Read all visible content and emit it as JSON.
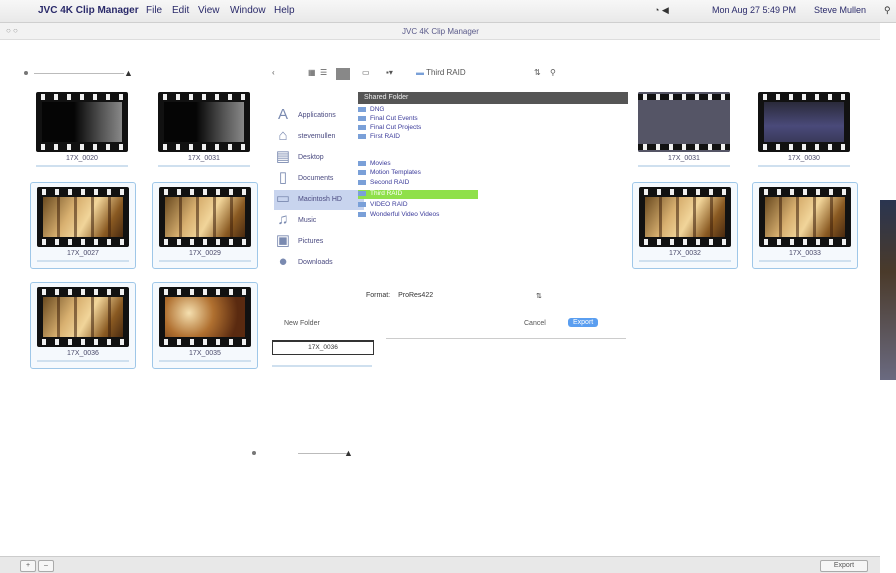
{
  "menubar": {
    "app_name": "JVC 4K Clip Manager",
    "menus": [
      "File",
      "Edit",
      "View",
      "Window",
      "Help"
    ],
    "status_text": "Mon Aug 27 5:49 PM",
    "user": "Steve Mullen"
  },
  "window": {
    "title": "JVC 4K Clip Manager"
  },
  "clips_left": [
    {
      "name": "17X_0020",
      "style": "dark"
    },
    {
      "name": "17X_0031",
      "style": "dark"
    },
    {
      "name": "17X_0027",
      "style": "warm"
    },
    {
      "name": "17X_0029",
      "style": "warm"
    },
    {
      "name": "17X_0036",
      "style": "warm"
    },
    {
      "name": "17X_0035",
      "style": "fest"
    }
  ],
  "clips_right": [
    {
      "name": "17X_0031",
      "style": "grayish"
    },
    {
      "name": "17X_0030",
      "style": "bluish"
    },
    {
      "name": "17X_0032",
      "style": "warm"
    },
    {
      "name": "17X_0033",
      "style": "warm"
    }
  ],
  "dialog": {
    "toolbar_path": "Third RAID",
    "sidebar": [
      {
        "label": "Applications",
        "icon": "applications-icon"
      },
      {
        "label": "stevemullen",
        "icon": "home-icon"
      },
      {
        "label": "Desktop",
        "icon": "desktop-icon"
      },
      {
        "label": "Documents",
        "icon": "documents-icon"
      },
      {
        "label": "Macintosh HD",
        "icon": "harddrive-icon"
      },
      {
        "label": "Music",
        "icon": "music-icon"
      },
      {
        "label": "Pictures",
        "icon": "pictures-icon"
      },
      {
        "label": "Downloads",
        "icon": "downloads-icon"
      }
    ],
    "folder_header": "Shared Folder",
    "folders": [
      {
        "label": "DNG"
      },
      {
        "label": "Final Cut Events"
      },
      {
        "label": "Final Cut Projects"
      },
      {
        "label": "First RAID"
      },
      {
        "label": "Movies"
      },
      {
        "label": "Motion Templates"
      },
      {
        "label": "Second RAID"
      },
      {
        "label": "Third RAID",
        "selected": true
      },
      {
        "label": "VIDEO RAID"
      },
      {
        "label": "Wonderful Video Videos"
      }
    ],
    "format_label": "Format:",
    "format_value": "ProRes422",
    "new_folder": "New Folder",
    "cancel": "Cancel",
    "export": "Export",
    "new_clip_name": "17X_0036"
  },
  "bottom": {
    "right_button": "Export"
  }
}
